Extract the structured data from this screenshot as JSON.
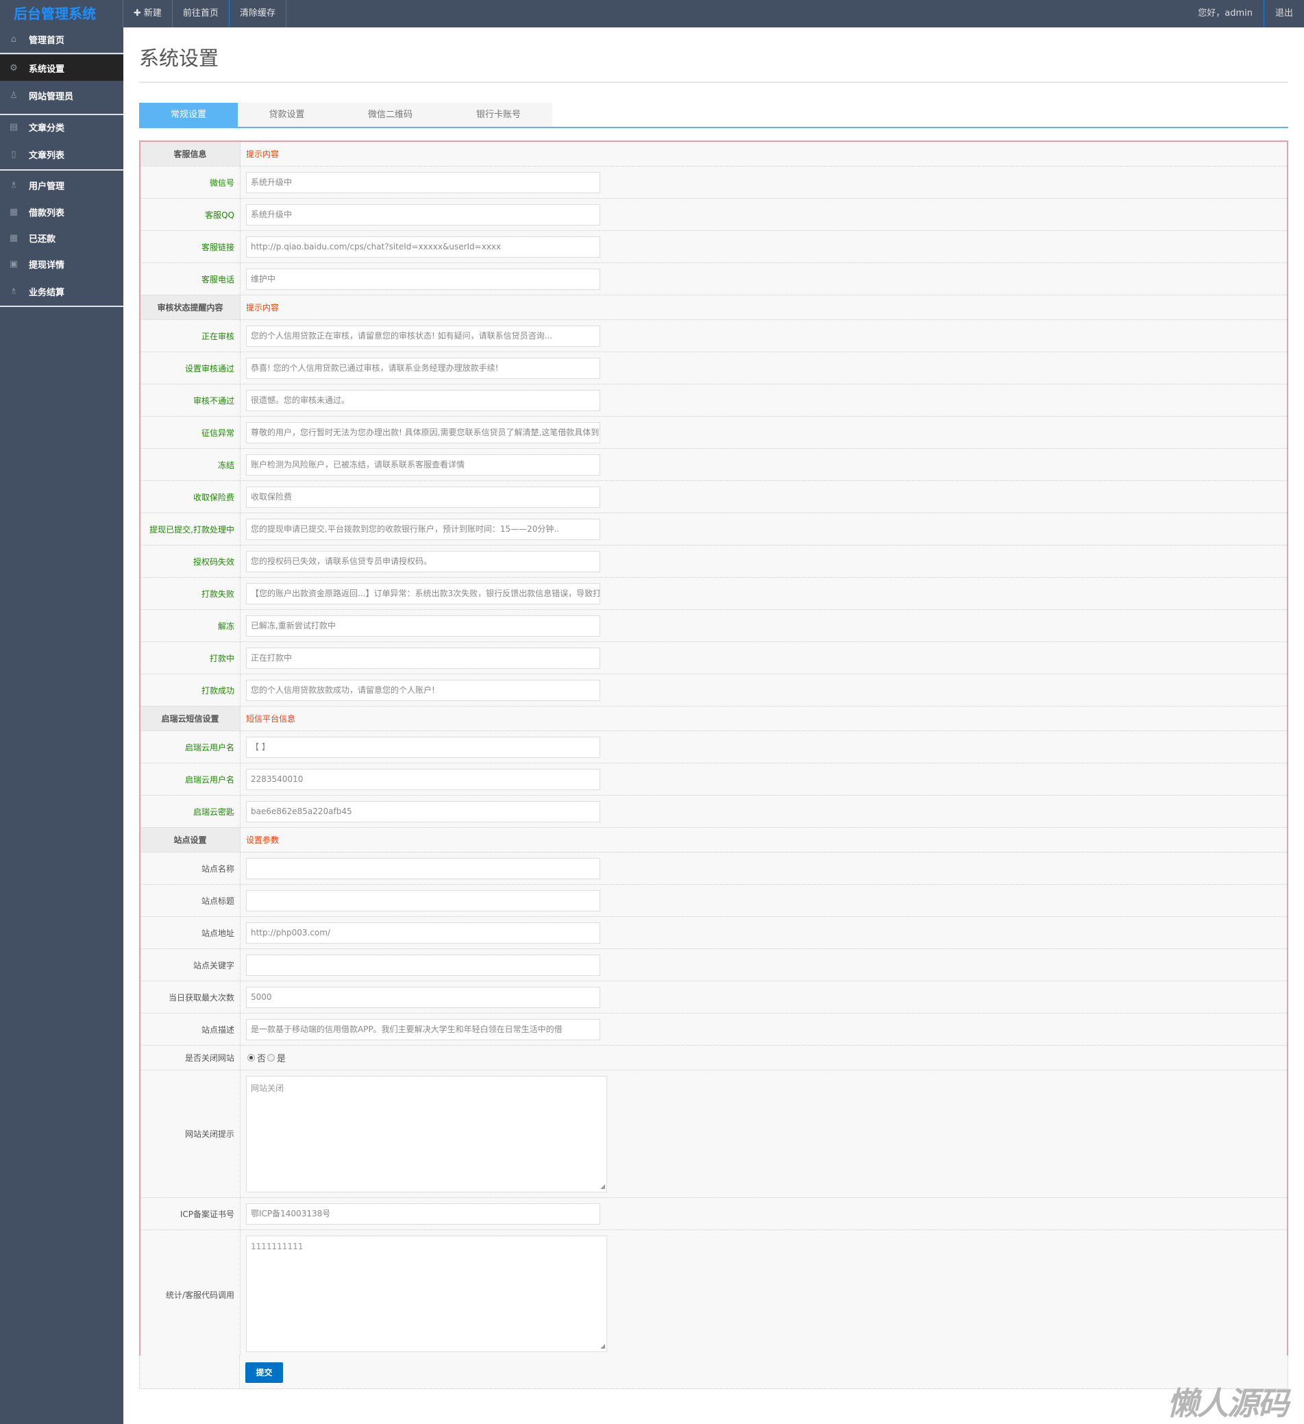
{
  "header": {
    "logo": "后台管理系统",
    "nav": [
      {
        "icon": "plus-icon",
        "label": "新建"
      },
      {
        "label": "前往首页"
      },
      {
        "label": "清除缓存"
      }
    ],
    "greeting": "您好，admin",
    "logout": "退出"
  },
  "sidebar": {
    "items": [
      {
        "label": "管理首页",
        "icon": "home-icon"
      },
      {
        "label": "系统设置",
        "icon": "gear-icon",
        "active": true
      },
      {
        "label": "网站管理员",
        "icon": "user-icon"
      },
      {
        "label": "文章分类",
        "icon": "book-icon"
      },
      {
        "label": "文章列表",
        "icon": "file-icon"
      },
      {
        "label": "用户管理",
        "icon": "users-icon"
      },
      {
        "label": "借款列表",
        "icon": "grid-icon"
      },
      {
        "label": "已还款",
        "icon": "grid-icon"
      },
      {
        "label": "提现详情",
        "icon": "inbox-icon"
      },
      {
        "label": "业务结算",
        "icon": "users-icon"
      }
    ]
  },
  "page": {
    "title": "系统设置",
    "tabs": [
      "常规设置",
      "贷款设置",
      "微信二维码",
      "银行卡账号"
    ]
  },
  "sections": [
    {
      "title": "客服信息",
      "hint": "提示内容",
      "fields": [
        {
          "label": "微信号",
          "value": "系统升级中",
          "green": true
        },
        {
          "label": "客服QQ",
          "value": "系统升级中",
          "green": true
        },
        {
          "label": "客服链接",
          "value": "http://p.qiao.baidu.com/cps/chat?siteId=xxxxx&userId=xxxx",
          "green": true
        },
        {
          "label": "客服电话",
          "value": "维护中",
          "green": true
        }
      ]
    },
    {
      "title": "审核状态提醒内容",
      "hint": "提示内容",
      "fields": [
        {
          "label": "正在审核",
          "value": "您的个人信用贷款正在审核，请留意您的审核状态! 如有疑问，请联系信贷员咨询...",
          "green": true
        },
        {
          "label": "设置审核通过",
          "value": "恭喜! 您的个人信用贷款已通过审核，请联系业务经理办理放款手续!",
          "green": true
        },
        {
          "label": "审核不通过",
          "value": "很遗憾。您的审核未通过。",
          "green": true
        },
        {
          "label": "征信异常",
          "value": "尊敬的用户，您行暂时无法为您办理出款! 具体原因,需要您联系信贷员了解清楚,这笔借款具体到",
          "green": true
        },
        {
          "label": "冻结",
          "value": "账户检测为风险账户，已被冻结，请联系联系客服查看详情",
          "green": true
        },
        {
          "label": "收取保险费",
          "value": "收取保险费",
          "green": true
        },
        {
          "label": "提现已提交,打款处理中",
          "value": "您的提现申请已提交,平台拨款到您的收款银行账户，预计到账时间：15——20分钟..",
          "green": true
        },
        {
          "label": "授权码失效",
          "value": "您的授权码已失效，请联系信贷专员申请授权码。",
          "green": true
        },
        {
          "label": "打款失败",
          "value": "【您的账户出款资金原路返回...】订单异常：系统出款3次失败，银行反馈出款信息错误，导致打",
          "green": true
        },
        {
          "label": "解冻",
          "value": "已解冻,重新尝试打款中",
          "green": true
        },
        {
          "label": "打款中",
          "value": "正在打款中",
          "green": true
        },
        {
          "label": "打款成功",
          "value": "您的个人信用贷款放款成功，请留意您的个人账户!",
          "green": true
        }
      ]
    },
    {
      "title": "启瑞云短信设置",
      "hint": "短信平台信息",
      "fields": [
        {
          "label": "启瑞云用户名",
          "value": "【        】",
          "green": true
        },
        {
          "label": "启瑞云用户名",
          "value": "2283540010",
          "green": true
        },
        {
          "label": "启瑞云密匙",
          "value": "bae6e862e85a220afb45",
          "green": true
        }
      ]
    },
    {
      "title": "站点设置",
      "hint": "设置参数",
      "fields": [
        {
          "label": "站点名称",
          "value": ""
        },
        {
          "label": "站点标题",
          "value": ""
        },
        {
          "label": "站点地址",
          "value": "http://php003.com/"
        },
        {
          "label": "站点关键字",
          "value": ""
        },
        {
          "label": "当日获取最大次数",
          "value": "5000"
        },
        {
          "label": "站点描述",
          "value": "        是一款基于移动端的信用借款APP。我们主要解决大学生和年轻白领在日常生活中的借"
        },
        {
          "label": "是否关闭网站",
          "type": "radio",
          "options": [
            "否",
            "是"
          ],
          "selected": 0
        },
        {
          "label": "网站关闭提示",
          "type": "textarea",
          "value": "网站关闭"
        },
        {
          "label": "ICP备案证书号",
          "value": "鄂ICP备14003138号"
        },
        {
          "label": "统计/客服代码调用",
          "type": "textarea",
          "value": "1111111111"
        }
      ]
    }
  ],
  "submit_label": "提交",
  "watermark": "懒人源码"
}
